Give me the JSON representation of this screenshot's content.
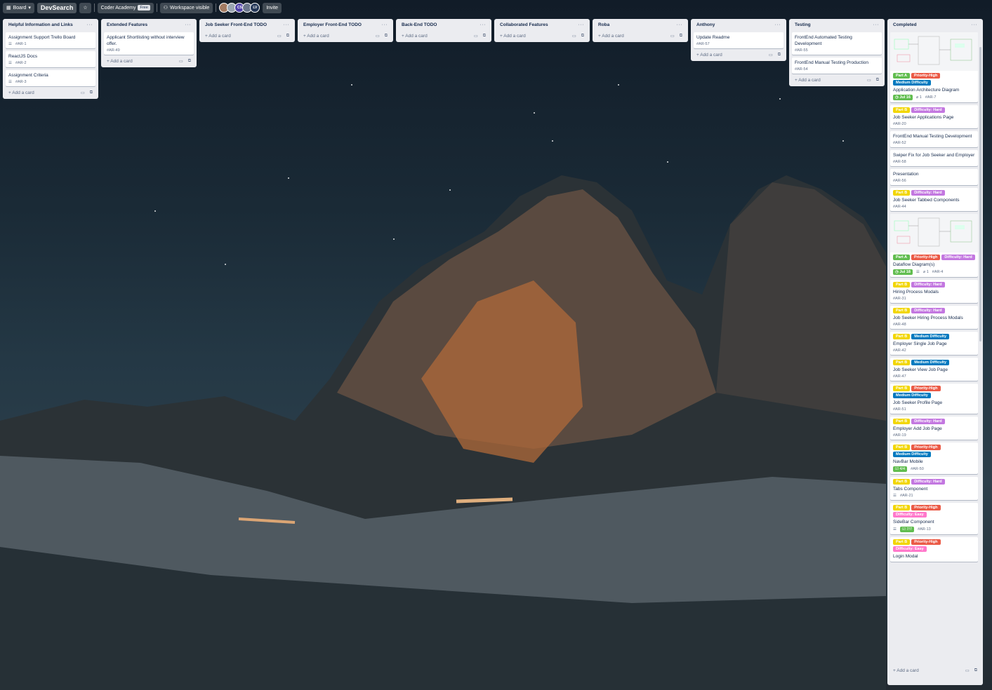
{
  "topbar": {
    "view_label": "Board",
    "board_title": "DevSearch",
    "workspace": "Coder Academy",
    "workspace_plan": "Free",
    "visibility": "Workspace visible",
    "invite_label": "Invite",
    "members": [
      {
        "initials": "",
        "color": "#a37b62"
      },
      {
        "initials": "",
        "color": "#9aa5b1"
      },
      {
        "initials": "CS",
        "color": "#5243aa"
      },
      {
        "initials": "",
        "color": "#6b778c"
      },
      {
        "initials": "LV",
        "color": "#253858"
      }
    ]
  },
  "icons": {
    "board": "board-icon",
    "chevron": "chevron-down-icon",
    "star": "star-icon",
    "visibility": "people-icon",
    "description": "description-icon",
    "attachment": "paperclip-icon",
    "clock": "clock-icon",
    "checklist": "checklist-icon",
    "template": "template-icon",
    "add": "plus-icon",
    "menu": "ellipsis-icon"
  },
  "colors": {
    "green": "#61bd4f",
    "yellow": "#f2d600",
    "red": "#eb5a46",
    "blue": "#0079bf",
    "purple": "#c377e0",
    "pink": "#ff78cb"
  },
  "add_card_label": "Add a card",
  "lists": [
    {
      "title": "Helpful Information and Links",
      "cards": [
        {
          "title": "Assignment Support Trello Board",
          "id": "#AR-1",
          "desc": true
        },
        {
          "title": "ReactJS Docs",
          "id": "#AR-2",
          "desc": true
        },
        {
          "title": "Assignment Criteria",
          "id": "#AR-3",
          "desc": true
        }
      ]
    },
    {
      "title": "Extended Features",
      "cards": [
        {
          "title": "Applicant Shortlisting without interview offer.",
          "id": "#AR-49"
        }
      ]
    },
    {
      "title": "Job Seeker Front-End TODO",
      "cards": []
    },
    {
      "title": "Employer Front-End TODO",
      "cards": []
    },
    {
      "title": "Back-End TODO",
      "cards": []
    },
    {
      "title": "Collaborated Features",
      "cards": []
    },
    {
      "title": "Roba",
      "cards": []
    },
    {
      "title": "Anthony",
      "cards": [
        {
          "title": "Update Readme",
          "id": "#AR-57"
        }
      ]
    },
    {
      "title": "Testing",
      "cards": [
        {
          "title": "FrontEnd Automated Testing Development",
          "id": "#AR-55"
        },
        {
          "title": "FrontEnd Manual Testing Production",
          "id": "#AR-54"
        }
      ]
    },
    {
      "title": "Completed",
      "cards": [
        {
          "cover": true,
          "labels": [
            [
              "Part A",
              "green"
            ],
            [
              "Priority-High",
              "red"
            ],
            [
              "Medium Difficulty",
              "blue"
            ]
          ],
          "title": "Application Architecture Diagram",
          "due": "Jul 16",
          "attach": "1",
          "id": "#AR-7"
        },
        {
          "labels": [
            [
              "Part B",
              "yellow"
            ],
            [
              "Difficulty: Hard",
              "purple"
            ]
          ],
          "title": "Job Seeker Applications Page",
          "id": "#AR-20"
        },
        {
          "title": "FrontEnd Manual Testing Development",
          "id": "#AR-52"
        },
        {
          "title": "Swiper Fix for Job Seeker and Employer",
          "id": "#AR-58"
        },
        {
          "title": "Presentation",
          "id": "#AR-56"
        },
        {
          "labels": [
            [
              "Part B",
              "yellow"
            ],
            [
              "Difficulty: Hard",
              "purple"
            ]
          ],
          "title": "Job Seeker Tabbed Components",
          "id": "#AR-44"
        },
        {
          "cover": true,
          "labels": [
            [
              "Part A",
              "green"
            ],
            [
              "Priority-High",
              "red"
            ],
            [
              "Difficulty: Hard",
              "purple"
            ]
          ],
          "title": "Dataflow Diagram(s)",
          "due": "Jul 18",
          "desc": true,
          "attach": "1",
          "id": "#AR-4"
        },
        {
          "labels": [
            [
              "Part B",
              "yellow"
            ],
            [
              "Difficulty: Hard",
              "purple"
            ]
          ],
          "title": "Hiring Process Modals",
          "id": "#AR-31"
        },
        {
          "labels": [
            [
              "Part B",
              "yellow"
            ],
            [
              "Difficulty: Hard",
              "purple"
            ]
          ],
          "title": "Job Seeker Hiring Process Modals",
          "id": "#AR-48"
        },
        {
          "labels": [
            [
              "Part B",
              "yellow"
            ],
            [
              "Medium Difficulty",
              "blue"
            ]
          ],
          "title": "Employer Single Job Page",
          "id": "#AR-42"
        },
        {
          "labels": [
            [
              "Part B",
              "yellow"
            ],
            [
              "Medium Difficulty",
              "blue"
            ]
          ],
          "title": "Job Seeker View Job Page",
          "id": "#AR-47"
        },
        {
          "labels": [
            [
              "Part B",
              "yellow"
            ],
            [
              "Priority-High",
              "red"
            ],
            [
              "Medium Difficulty",
              "blue"
            ]
          ],
          "title": "Job Seeker Profile Page",
          "id": "#AR-51"
        },
        {
          "labels": [
            [
              "Part B",
              "yellow"
            ],
            [
              "Difficulty: Hard",
              "purple"
            ]
          ],
          "title": "Employer Add Job Page",
          "id": "#AR-19"
        },
        {
          "labels": [
            [
              "Part B",
              "yellow"
            ],
            [
              "Priority-High",
              "red"
            ],
            [
              "Medium Difficulty",
              "blue"
            ]
          ],
          "title": "NavBar Mobile",
          "check": "4/4",
          "id": "#AR-50"
        },
        {
          "labels": [
            [
              "Part B",
              "yellow"
            ],
            [
              "Difficulty: Hard",
              "purple"
            ]
          ],
          "title": "Tabs Component",
          "desc": true,
          "id": "#AR-21"
        },
        {
          "labels": [
            [
              "Part B",
              "yellow"
            ],
            [
              "Priority-High",
              "red"
            ],
            [
              "Difficulty: Easy",
              "pink"
            ]
          ],
          "title": "SideBar Component",
          "desc": true,
          "check": "7/7",
          "id": "#AR-13"
        },
        {
          "labels": [
            [
              "Part B",
              "yellow"
            ],
            [
              "Priority-High",
              "red"
            ],
            [
              "Difficulty: Easy",
              "pink"
            ]
          ],
          "title": "Login Modal"
        }
      ]
    }
  ]
}
